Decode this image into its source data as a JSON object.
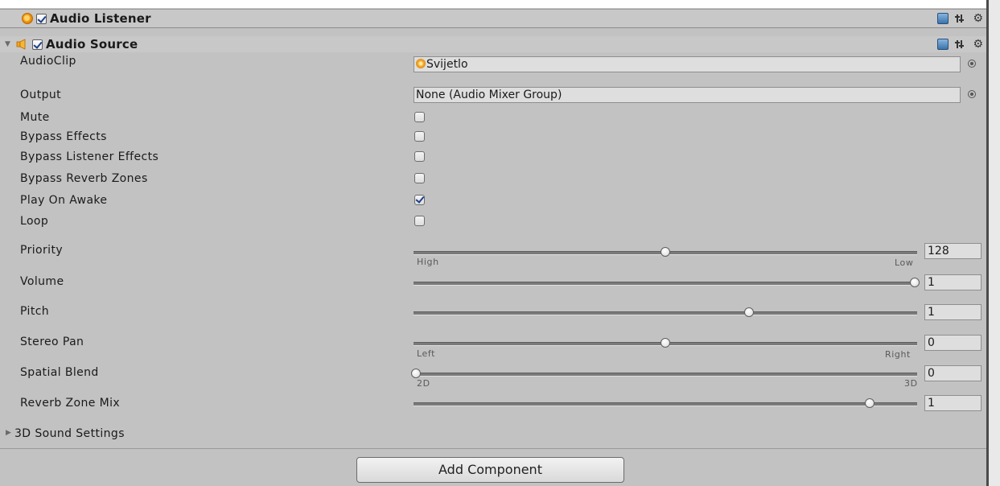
{
  "audio_listener": {
    "title": "Audio Listener",
    "enabled": true
  },
  "audio_source": {
    "title": "Audio Source",
    "enabled": true,
    "audio_clip": {
      "label": "AudioClip",
      "value": "Svijetlo"
    },
    "output": {
      "label": "Output",
      "value": "None (Audio Mixer Group)"
    },
    "toggles": [
      {
        "label": "Mute",
        "checked": false
      },
      {
        "label": "Bypass Effects",
        "checked": false
      },
      {
        "label": "Bypass Listener Effects",
        "checked": false
      },
      {
        "label": "Bypass Reverb Zones",
        "checked": false
      },
      {
        "label": "Play On Awake",
        "checked": true
      },
      {
        "label": "Loop",
        "checked": false
      }
    ],
    "sliders": [
      {
        "label": "Priority",
        "value": "128",
        "fraction": 0.5,
        "min_label": "High",
        "max_label": "Low"
      },
      {
        "label": "Volume",
        "value": "1",
        "fraction": 1.0,
        "min_label": "",
        "max_label": ""
      },
      {
        "label": "Pitch",
        "value": "1",
        "fraction": 0.667,
        "min_label": "",
        "max_label": ""
      },
      {
        "label": "Stereo Pan",
        "value": "0",
        "fraction": 0.5,
        "min_label": "Left",
        "max_label": "Right"
      },
      {
        "label": "Spatial Blend",
        "value": "0",
        "fraction": 0.0,
        "min_label": "2D",
        "max_label": "3D"
      },
      {
        "label": "Reverb Zone Mix",
        "value": "1",
        "fraction": 0.909,
        "min_label": "",
        "max_label": ""
      }
    ],
    "sound_settings": "3D Sound Settings"
  },
  "add_component": "Add Component",
  "icons": {
    "listener": "audio-listener-icon",
    "source": "speaker-icon",
    "help": "book-icon",
    "presets": "sliders-icon",
    "settings": "gear-icon",
    "picker": "object-picker-icon"
  }
}
